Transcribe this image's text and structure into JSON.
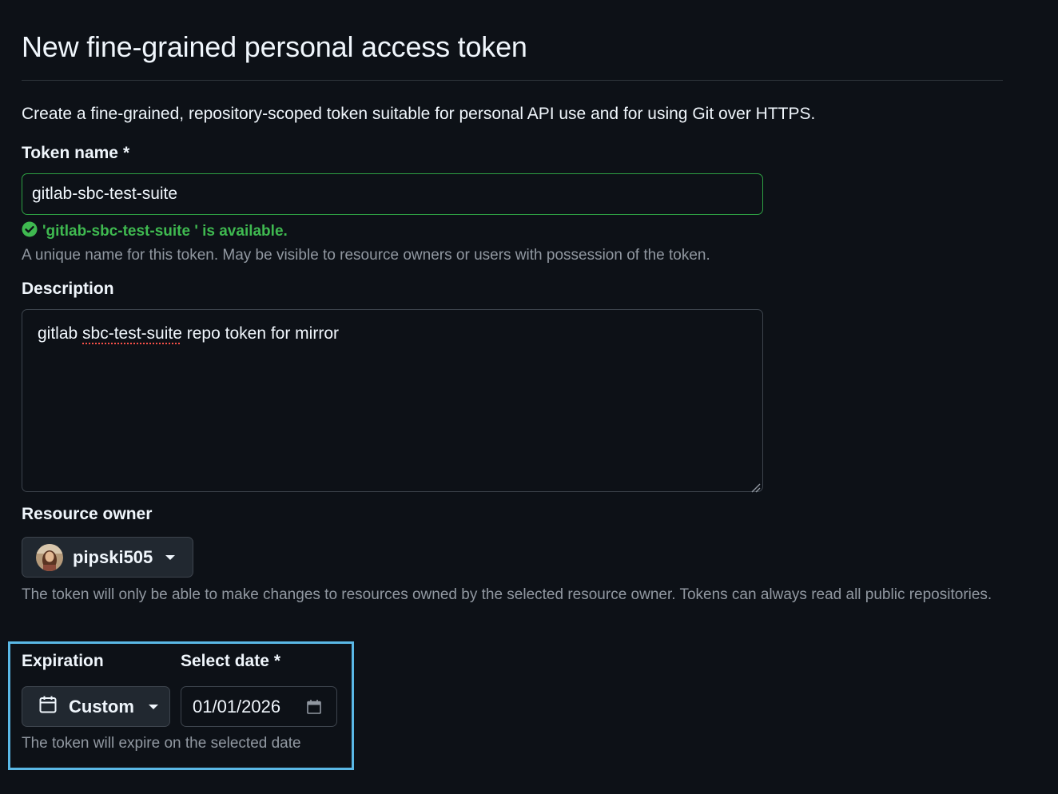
{
  "page": {
    "title": "New fine-grained personal access token",
    "intro": "Create a fine-grained, repository-scoped token suitable for personal API use and for using Git over HTTPS."
  },
  "token_name": {
    "label": "Token name",
    "required_mark": "*",
    "value": "gitlab-sbc-test-suite",
    "availability": "'gitlab-sbc-test-suite ' is available.",
    "help": "A unique name for this token. May be visible to resource owners or users with possession of the token."
  },
  "description": {
    "label": "Description",
    "value_part1": "gitlab ",
    "value_misspelled": "sbc-test-suite",
    "value_part2": " repo token for mirror"
  },
  "resource_owner": {
    "label": "Resource owner",
    "selected": "pipski505",
    "help": "The token will only be able to make changes to resources owned by the selected resource owner. Tokens can always read all public repositories."
  },
  "expiration": {
    "label": "Expiration",
    "selected": "Custom",
    "date_label": "Select date",
    "required_mark": "*",
    "date_value": "01/01/2026",
    "help": "The token will expire on the selected date"
  },
  "colors": {
    "background": "#0d1117",
    "success": "#3fb950",
    "highlight": "#5ab8e6",
    "muted": "#9198a1"
  }
}
